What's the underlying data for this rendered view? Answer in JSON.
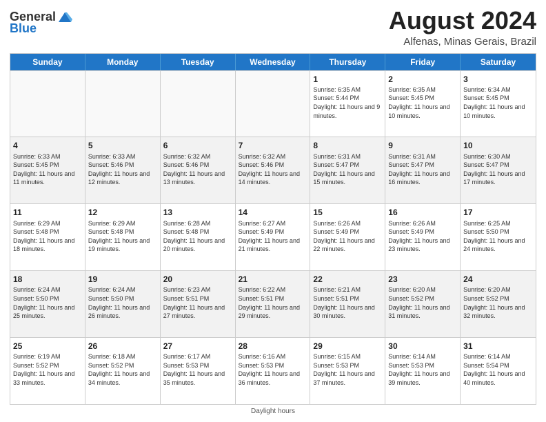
{
  "logo": {
    "general": "General",
    "blue": "Blue"
  },
  "title": {
    "month_year": "August 2024",
    "location": "Alfenas, Minas Gerais, Brazil"
  },
  "weekdays": [
    "Sunday",
    "Monday",
    "Tuesday",
    "Wednesday",
    "Thursday",
    "Friday",
    "Saturday"
  ],
  "rows": [
    [
      {
        "day": "",
        "info": "",
        "empty": true
      },
      {
        "day": "",
        "info": "",
        "empty": true
      },
      {
        "day": "",
        "info": "",
        "empty": true
      },
      {
        "day": "",
        "info": "",
        "empty": true
      },
      {
        "day": "1",
        "info": "Sunrise: 6:35 AM\nSunset: 5:44 PM\nDaylight: 11 hours and 9 minutes."
      },
      {
        "day": "2",
        "info": "Sunrise: 6:35 AM\nSunset: 5:45 PM\nDaylight: 11 hours and 10 minutes."
      },
      {
        "day": "3",
        "info": "Sunrise: 6:34 AM\nSunset: 5:45 PM\nDaylight: 11 hours and 10 minutes."
      }
    ],
    [
      {
        "day": "4",
        "info": "Sunrise: 6:33 AM\nSunset: 5:45 PM\nDaylight: 11 hours and 11 minutes."
      },
      {
        "day": "5",
        "info": "Sunrise: 6:33 AM\nSunset: 5:46 PM\nDaylight: 11 hours and 12 minutes."
      },
      {
        "day": "6",
        "info": "Sunrise: 6:32 AM\nSunset: 5:46 PM\nDaylight: 11 hours and 13 minutes."
      },
      {
        "day": "7",
        "info": "Sunrise: 6:32 AM\nSunset: 5:46 PM\nDaylight: 11 hours and 14 minutes."
      },
      {
        "day": "8",
        "info": "Sunrise: 6:31 AM\nSunset: 5:47 PM\nDaylight: 11 hours and 15 minutes."
      },
      {
        "day": "9",
        "info": "Sunrise: 6:31 AM\nSunset: 5:47 PM\nDaylight: 11 hours and 16 minutes."
      },
      {
        "day": "10",
        "info": "Sunrise: 6:30 AM\nSunset: 5:47 PM\nDaylight: 11 hours and 17 minutes."
      }
    ],
    [
      {
        "day": "11",
        "info": "Sunrise: 6:29 AM\nSunset: 5:48 PM\nDaylight: 11 hours and 18 minutes."
      },
      {
        "day": "12",
        "info": "Sunrise: 6:29 AM\nSunset: 5:48 PM\nDaylight: 11 hours and 19 minutes."
      },
      {
        "day": "13",
        "info": "Sunrise: 6:28 AM\nSunset: 5:48 PM\nDaylight: 11 hours and 20 minutes."
      },
      {
        "day": "14",
        "info": "Sunrise: 6:27 AM\nSunset: 5:49 PM\nDaylight: 11 hours and 21 minutes."
      },
      {
        "day": "15",
        "info": "Sunrise: 6:26 AM\nSunset: 5:49 PM\nDaylight: 11 hours and 22 minutes."
      },
      {
        "day": "16",
        "info": "Sunrise: 6:26 AM\nSunset: 5:49 PM\nDaylight: 11 hours and 23 minutes."
      },
      {
        "day": "17",
        "info": "Sunrise: 6:25 AM\nSunset: 5:50 PM\nDaylight: 11 hours and 24 minutes."
      }
    ],
    [
      {
        "day": "18",
        "info": "Sunrise: 6:24 AM\nSunset: 5:50 PM\nDaylight: 11 hours and 25 minutes."
      },
      {
        "day": "19",
        "info": "Sunrise: 6:24 AM\nSunset: 5:50 PM\nDaylight: 11 hours and 26 minutes."
      },
      {
        "day": "20",
        "info": "Sunrise: 6:23 AM\nSunset: 5:51 PM\nDaylight: 11 hours and 27 minutes."
      },
      {
        "day": "21",
        "info": "Sunrise: 6:22 AM\nSunset: 5:51 PM\nDaylight: 11 hours and 29 minutes."
      },
      {
        "day": "22",
        "info": "Sunrise: 6:21 AM\nSunset: 5:51 PM\nDaylight: 11 hours and 30 minutes."
      },
      {
        "day": "23",
        "info": "Sunrise: 6:20 AM\nSunset: 5:52 PM\nDaylight: 11 hours and 31 minutes."
      },
      {
        "day": "24",
        "info": "Sunrise: 6:20 AM\nSunset: 5:52 PM\nDaylight: 11 hours and 32 minutes."
      }
    ],
    [
      {
        "day": "25",
        "info": "Sunrise: 6:19 AM\nSunset: 5:52 PM\nDaylight: 11 hours and 33 minutes."
      },
      {
        "day": "26",
        "info": "Sunrise: 6:18 AM\nSunset: 5:52 PM\nDaylight: 11 hours and 34 minutes."
      },
      {
        "day": "27",
        "info": "Sunrise: 6:17 AM\nSunset: 5:53 PM\nDaylight: 11 hours and 35 minutes."
      },
      {
        "day": "28",
        "info": "Sunrise: 6:16 AM\nSunset: 5:53 PM\nDaylight: 11 hours and 36 minutes."
      },
      {
        "day": "29",
        "info": "Sunrise: 6:15 AM\nSunset: 5:53 PM\nDaylight: 11 hours and 37 minutes."
      },
      {
        "day": "30",
        "info": "Sunrise: 6:14 AM\nSunset: 5:53 PM\nDaylight: 11 hours and 39 minutes."
      },
      {
        "day": "31",
        "info": "Sunrise: 6:14 AM\nSunset: 5:54 PM\nDaylight: 11 hours and 40 minutes."
      }
    ]
  ],
  "footer": "Daylight hours"
}
